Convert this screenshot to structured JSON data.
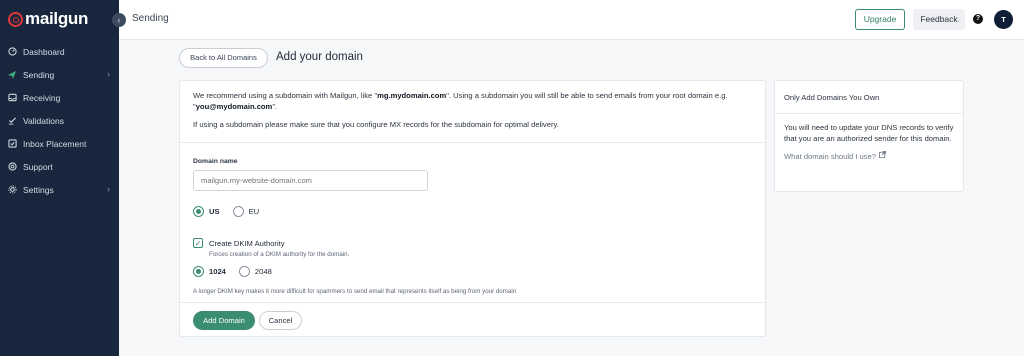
{
  "brand": {
    "name": "mailgun",
    "accent": "#e1363b",
    "primary_green": "#3a8d6e",
    "sidebar_bg": "#18273d"
  },
  "sidebar": {
    "items": [
      {
        "label": "Dashboard",
        "icon": "dashboard-icon",
        "has_chevron": false
      },
      {
        "label": "Sending",
        "icon": "paper-plane-icon",
        "has_chevron": true
      },
      {
        "label": "Receiving",
        "icon": "inbox-icon",
        "has_chevron": false
      },
      {
        "label": "Validations",
        "icon": "validation-icon",
        "has_chevron": false
      },
      {
        "label": "Inbox Placement",
        "icon": "checkbox-icon",
        "has_chevron": false
      },
      {
        "label": "Support",
        "icon": "support-icon",
        "has_chevron": false
      },
      {
        "label": "Settings",
        "icon": "gear-icon",
        "has_chevron": true
      }
    ]
  },
  "topbar": {
    "title": "Sending",
    "upgrade_label": "Upgrade",
    "feedback_label": "Feedback",
    "help_glyph": "?",
    "avatar_initial": "T"
  },
  "page": {
    "back_label": "Back to All Domains",
    "title": "Add your domain"
  },
  "form": {
    "intro_part1": "We recommend using a subdomain with Mailgun, like \"",
    "intro_example1": "mg.mydomain.com",
    "intro_part2": "\". Using a subdomain you will still be able to send emails from your root domain e.g. \"",
    "intro_example2": "you@mydomain.com",
    "intro_part3": "\".",
    "intro_note": "If using a subdomain please make sure that you configure MX records for the subdomain for optimal delivery.",
    "domain_label": "Domain name",
    "domain_placeholder": "mailgun.my-website-domain.com",
    "region_options": [
      "US",
      "EU"
    ],
    "region_selected": "US",
    "dkim_label": "Create DKIM Authority",
    "dkim_checked": true,
    "dkim_sub": "Forces creation of a DKIM authority for the domain.",
    "dkim_key_options": [
      "1024",
      "2048"
    ],
    "dkim_key_selected": "1024",
    "dkim_hint": "A longer DKIM key makes it more difficult for spammers to send email that represents itself as being from your domain",
    "add_label": "Add Domain",
    "cancel_label": "Cancel"
  },
  "side_panel": {
    "title": "Only Add Domains You Own",
    "body": "You will need to update your DNS records to verify that you are an authorized sender for this domain.",
    "link_label": "What domain should I use?",
    "link_icon": "external-link-icon"
  }
}
